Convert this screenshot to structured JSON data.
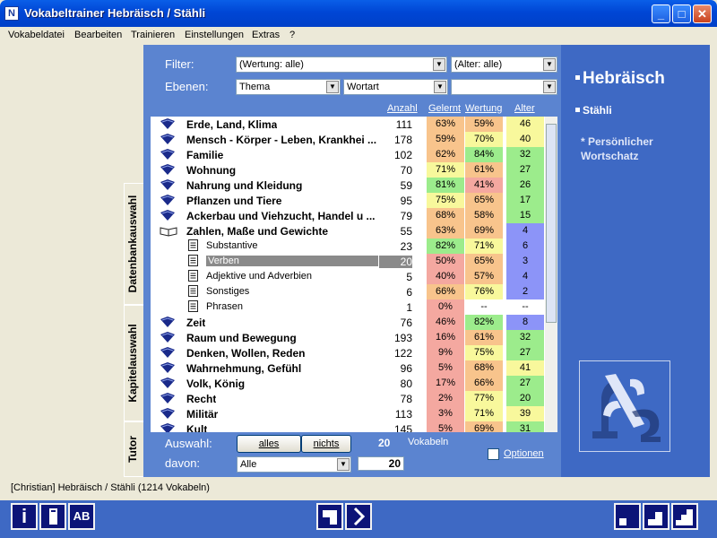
{
  "window": {
    "title": "Vokabeltrainer Hebräisch / Stähli",
    "app_icon": "N",
    "btn_min": "_",
    "btn_max": "□",
    "btn_close": "✕"
  },
  "menu": [
    "Vokabeldatei",
    "Bearbeiten",
    "Trainieren",
    "Einstellungen",
    "Extras",
    "?"
  ],
  "filter": {
    "label": "Filter:",
    "wertung": "(Wertung: alle)",
    "alter": "(Alter: alle)"
  },
  "ebenen": {
    "label": "Ebenen:",
    "level1": "Thema",
    "level2": "Wortart",
    "level3": ""
  },
  "columns": {
    "anzahl": "Anzahl",
    "gelernt": "Gelernt",
    "wertung": "Wertung",
    "alter": "Alter"
  },
  "rows": [
    {
      "name": "Erde, Land, Klima",
      "anzahl": "111",
      "gelernt": "63%",
      "wertung": "59%",
      "alter": "46",
      "level": 0,
      "icon": "book"
    },
    {
      "name": "Mensch - Körper - Leben, Krankhei ...",
      "anzahl": "178",
      "gelernt": "59%",
      "wertung": "70%",
      "alter": "40",
      "level": 0,
      "icon": "book"
    },
    {
      "name": "Familie",
      "anzahl": "102",
      "gelernt": "62%",
      "wertung": "84%",
      "alter": "32",
      "level": 0,
      "icon": "book"
    },
    {
      "name": "Wohnung",
      "anzahl": "70",
      "gelernt": "71%",
      "wertung": "61%",
      "alter": "27",
      "level": 0,
      "icon": "book"
    },
    {
      "name": "Nahrung und Kleidung",
      "anzahl": "59",
      "gelernt": "81%",
      "wertung": "41%",
      "alter": "26",
      "level": 0,
      "icon": "book"
    },
    {
      "name": "Pflanzen und Tiere",
      "anzahl": "95",
      "gelernt": "75%",
      "wertung": "65%",
      "alter": "17",
      "level": 0,
      "icon": "book"
    },
    {
      "name": "Ackerbau und Viehzucht, Handel u ...",
      "anzahl": "79",
      "gelernt": "68%",
      "wertung": "58%",
      "alter": "15",
      "level": 0,
      "icon": "book"
    },
    {
      "name": "Zahlen, Maße und Gewichte",
      "anzahl": "55",
      "gelernt": "63%",
      "wertung": "69%",
      "alter": "4",
      "level": 0,
      "icon": "open-book"
    },
    {
      "name": "Substantive",
      "anzahl": "23",
      "gelernt": "82%",
      "wertung": "71%",
      "alter": "6",
      "level": 1,
      "icon": "doc"
    },
    {
      "name": "Verben",
      "anzahl": "20",
      "gelernt": "50%",
      "wertung": "65%",
      "alter": "3",
      "level": 1,
      "icon": "doc",
      "selected": true
    },
    {
      "name": "Adjektive und Adverbien",
      "anzahl": "5",
      "gelernt": "40%",
      "wertung": "57%",
      "alter": "4",
      "level": 1,
      "icon": "doc"
    },
    {
      "name": "Sonstiges",
      "anzahl": "6",
      "gelernt": "66%",
      "wertung": "76%",
      "alter": "2",
      "level": 1,
      "icon": "doc"
    },
    {
      "name": "Phrasen",
      "anzahl": "1",
      "gelernt": "0%",
      "wertung": "--",
      "alter": "--",
      "level": 1,
      "icon": "doc"
    },
    {
      "name": "Zeit",
      "anzahl": "76",
      "gelernt": "46%",
      "wertung": "82%",
      "alter": "8",
      "level": 0,
      "icon": "book"
    },
    {
      "name": "Raum und Bewegung",
      "anzahl": "193",
      "gelernt": "16%",
      "wertung": "61%",
      "alter": "32",
      "level": 0,
      "icon": "book"
    },
    {
      "name": "Denken, Wollen, Reden",
      "anzahl": "122",
      "gelernt": "9%",
      "wertung": "75%",
      "alter": "27",
      "level": 0,
      "icon": "book"
    },
    {
      "name": "Wahrnehmung, Gefühl",
      "anzahl": "96",
      "gelernt": "5%",
      "wertung": "68%",
      "alter": "41",
      "level": 0,
      "icon": "book"
    },
    {
      "name": "Volk, König",
      "anzahl": "80",
      "gelernt": "17%",
      "wertung": "66%",
      "alter": "27",
      "level": 0,
      "icon": "book"
    },
    {
      "name": "Recht",
      "anzahl": "78",
      "gelernt": "2%",
      "wertung": "77%",
      "alter": "20",
      "level": 0,
      "icon": "book"
    },
    {
      "name": "Militär",
      "anzahl": "113",
      "gelernt": "3%",
      "wertung": "71%",
      "alter": "39",
      "level": 0,
      "icon": "book"
    },
    {
      "name": "Kult",
      "anzahl": "145",
      "gelernt": "5%",
      "wertung": "69%",
      "alter": "31",
      "level": 0,
      "icon": "book"
    }
  ],
  "selection": {
    "label": "Auswahl:",
    "btn_all": "alles",
    "btn_none": "nichts",
    "count": "20",
    "count_label": "Vokabeln",
    "davon_label": "davon:",
    "davon_select": "Alle",
    "davon_value": "20",
    "optionen": "Optionen"
  },
  "tabs": {
    "datenbank": "Datenbankauswahl",
    "kapitel": "Kapitelauswahl",
    "tutor": "Tutor"
  },
  "info": {
    "title": "Hebräisch",
    "author": "Stähli",
    "note": "* Persönlicher Wortschatz"
  },
  "status": "[Christian]  Hebräisch / Stähli  (1214 Vokabeln)",
  "toolbar": {
    "info": "i",
    "ab": "AB"
  },
  "colors": {
    "red": "#f4a8a0",
    "orange": "#f8c48c",
    "yellow": "#f8f89c",
    "green": "#9cec8c",
    "blue": "#8c94f8",
    "panel": "#5b84d0",
    "right_panel": "#3e69c4",
    "bottom": "#3e69c4"
  }
}
